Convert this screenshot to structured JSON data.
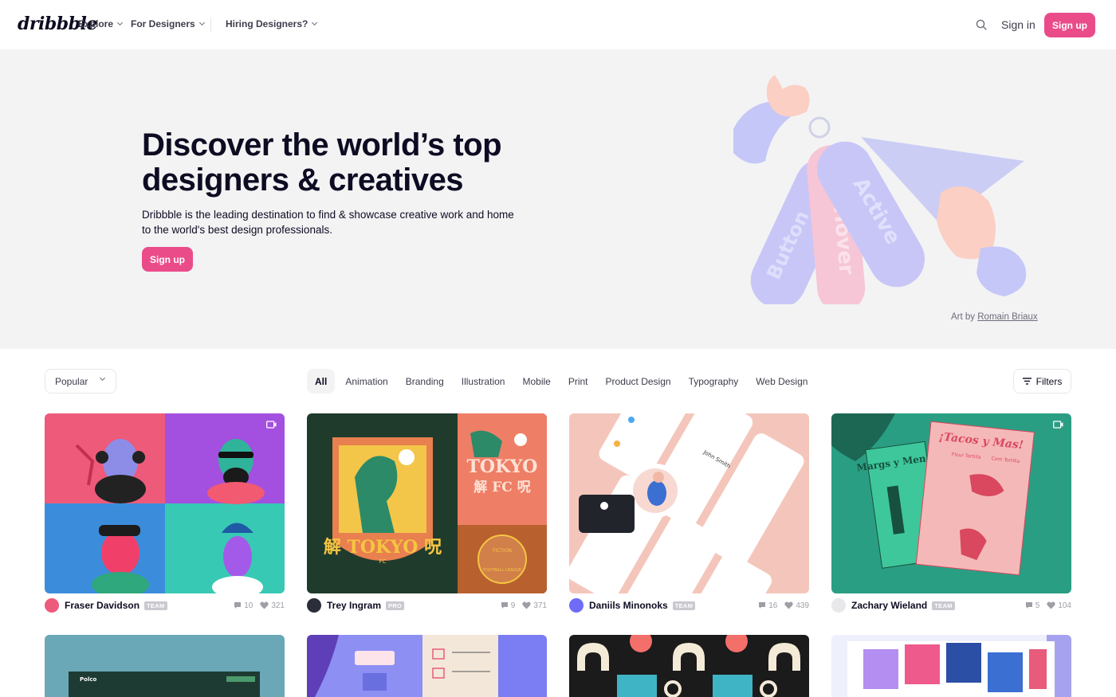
{
  "nav": {
    "logo": "dribbble",
    "explore": "Explore",
    "for_designers": "For Designers",
    "hiring": "Hiring Designers?",
    "signin": "Sign in",
    "signup": "Sign up"
  },
  "hero": {
    "title": "Discover the world’s top designers & creatives",
    "description": "Dribbble is the leading destination to find & showcase creative work and home to the world's best design professionals.",
    "button": "Sign up",
    "art_prefix": "Art by",
    "art_author": "Romain Briaux",
    "art_labels": [
      "Button",
      "Hover",
      "Active"
    ]
  },
  "filters": {
    "sort": "Popular",
    "categories": [
      "All",
      "Animation",
      "Branding",
      "Illustration",
      "Mobile",
      "Print",
      "Product Design",
      "Typography",
      "Web Design"
    ],
    "active_category": "All",
    "filters_label": "Filters"
  },
  "shots": [
    {
      "author": "Fraser Davidson",
      "badge": "TEAM",
      "comments": "10",
      "likes": "321",
      "video": true
    },
    {
      "author": "Trey Ingram",
      "badge": "PRO",
      "comments": "9",
      "likes": "371",
      "video": false,
      "art_text": [
        "TOKYO",
        "解 FC 呪",
        "解 TOKYO 呪",
        "FC",
        "FICTION",
        "FOOTBALL LEAGUE"
      ]
    },
    {
      "author": "Daniils Minonoks",
      "badge": "TEAM",
      "comments": "16",
      "likes": "439",
      "video": false,
      "art_text": [
        "John Smith"
      ]
    },
    {
      "author": "Zachary Wieland",
      "badge": "TEAM",
      "comments": "5",
      "likes": "104",
      "video": true,
      "art_text": [
        "¡Tacos y Mas!",
        "Margs y Menos",
        "Flour Tortilla",
        "Corn Tortilla"
      ]
    }
  ],
  "row2_text": {
    "polco": "Polco"
  },
  "colors": {
    "brand_pink": "#ea4c89",
    "hero_bg": "#f3f3f4",
    "text_dark": "#0d0c22",
    "muted": "#6e6d7a"
  }
}
